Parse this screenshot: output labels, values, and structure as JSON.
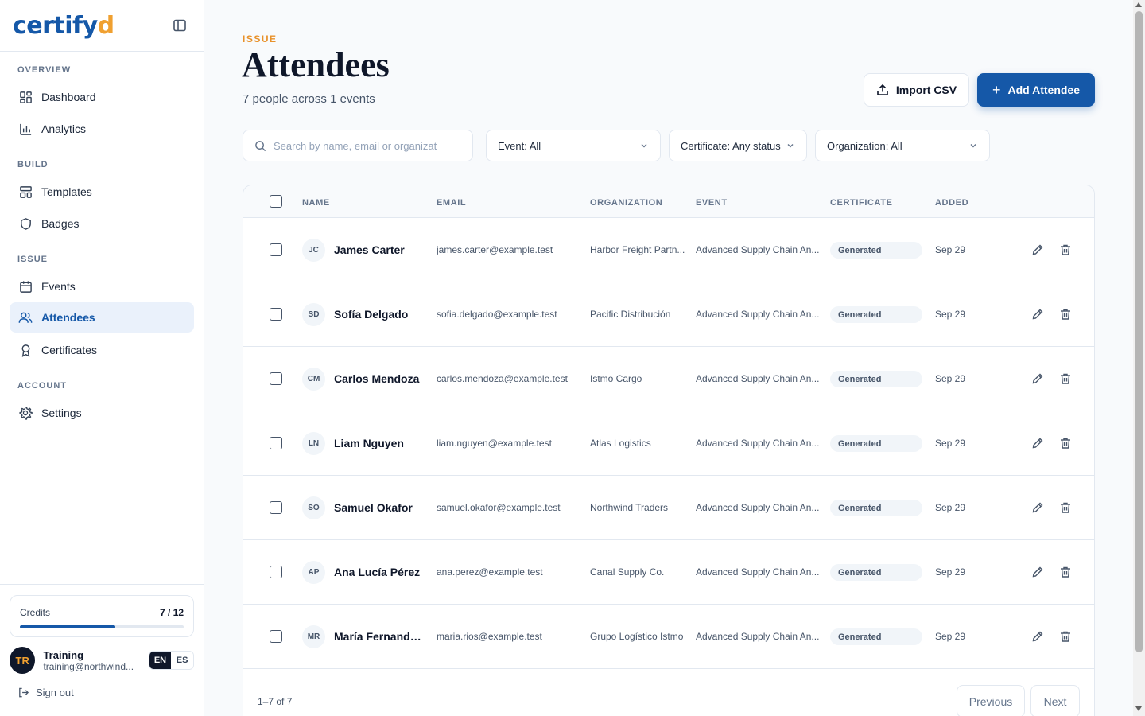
{
  "brand": {
    "logo_main": "certify",
    "logo_accent": "d"
  },
  "sidebar": {
    "sections": {
      "overview": "OVERVIEW",
      "build": "BUILD",
      "issue": "ISSUE",
      "account": "ACCOUNT"
    },
    "items": {
      "dashboard": {
        "label": "Dashboard",
        "icon": "dashboard-icon"
      },
      "analytics": {
        "label": "Analytics",
        "icon": "bar-chart-icon"
      },
      "templates": {
        "label": "Templates",
        "icon": "template-icon"
      },
      "badges": {
        "label": "Badges",
        "icon": "shield-icon"
      },
      "events": {
        "label": "Events",
        "icon": "calendar-icon"
      },
      "attendees": {
        "label": "Attendees",
        "icon": "users-icon",
        "active": true
      },
      "certificates": {
        "label": "Certificates",
        "icon": "award-icon"
      },
      "settings": {
        "label": "Settings",
        "icon": "gear-icon"
      }
    },
    "credits": {
      "label": "Credits",
      "count": "7 / 12",
      "used": 7,
      "total": 12
    },
    "user": {
      "initials": "TR",
      "name": "Training",
      "email": "training@northwind..."
    },
    "lang": {
      "en": "EN",
      "es": "ES",
      "active": "EN"
    },
    "signout": "Sign out"
  },
  "header": {
    "eyebrow": "ISSUE",
    "title": "Attendees",
    "subtitle": "7 people across 1 events",
    "import_label": "Import CSV",
    "add_label": "Add Attendee"
  },
  "filters": {
    "search_placeholder": "Search by name, email or organizat",
    "event": "Event: All",
    "certificate": "Certificate: Any status",
    "organization": "Organization: All"
  },
  "table": {
    "columns": {
      "name": "NAME",
      "email": "EMAIL",
      "organization": "ORGANIZATION",
      "event": "EVENT",
      "certificate": "CERTIFICATE",
      "added": "ADDED"
    },
    "rows": [
      {
        "initials": "JC",
        "name": "James Carter",
        "email": "james.carter@example.test",
        "organization": "Harbor Freight Partn...",
        "event": "Advanced Supply Chain An...",
        "certificate": "Generated",
        "added": "Sep 29"
      },
      {
        "initials": "SD",
        "name": "Sofía Delgado",
        "email": "sofia.delgado@example.test",
        "organization": "Pacific Distribución",
        "event": "Advanced Supply Chain An...",
        "certificate": "Generated",
        "added": "Sep 29"
      },
      {
        "initials": "CM",
        "name": "Carlos Mendoza",
        "email": "carlos.mendoza@example.test",
        "organization": "Istmo Cargo",
        "event": "Advanced Supply Chain An...",
        "certificate": "Generated",
        "added": "Sep 29"
      },
      {
        "initials": "LN",
        "name": "Liam Nguyen",
        "email": "liam.nguyen@example.test",
        "organization": "Atlas Logistics",
        "event": "Advanced Supply Chain An...",
        "certificate": "Generated",
        "added": "Sep 29"
      },
      {
        "initials": "SO",
        "name": "Samuel Okafor",
        "email": "samuel.okafor@example.test",
        "organization": "Northwind Traders",
        "event": "Advanced Supply Chain An...",
        "certificate": "Generated",
        "added": "Sep 29"
      },
      {
        "initials": "AP",
        "name": "Ana Lucía Pérez",
        "email": "ana.perez@example.test",
        "organization": "Canal Supply Co.",
        "event": "Advanced Supply Chain An...",
        "certificate": "Generated",
        "added": "Sep 29"
      },
      {
        "initials": "MR",
        "name": "María Fernanda ...",
        "email": "maria.rios@example.test",
        "organization": "Grupo Logístico Istmo",
        "event": "Advanced Supply Chain An...",
        "certificate": "Generated",
        "added": "Sep 29"
      }
    ],
    "footer": {
      "range": "1–7 of 7",
      "previous": "Previous",
      "next": "Next"
    }
  },
  "colors": {
    "primary": "#1558a8",
    "accent": "#e8912a",
    "active_bg": "#eaf1fb"
  }
}
